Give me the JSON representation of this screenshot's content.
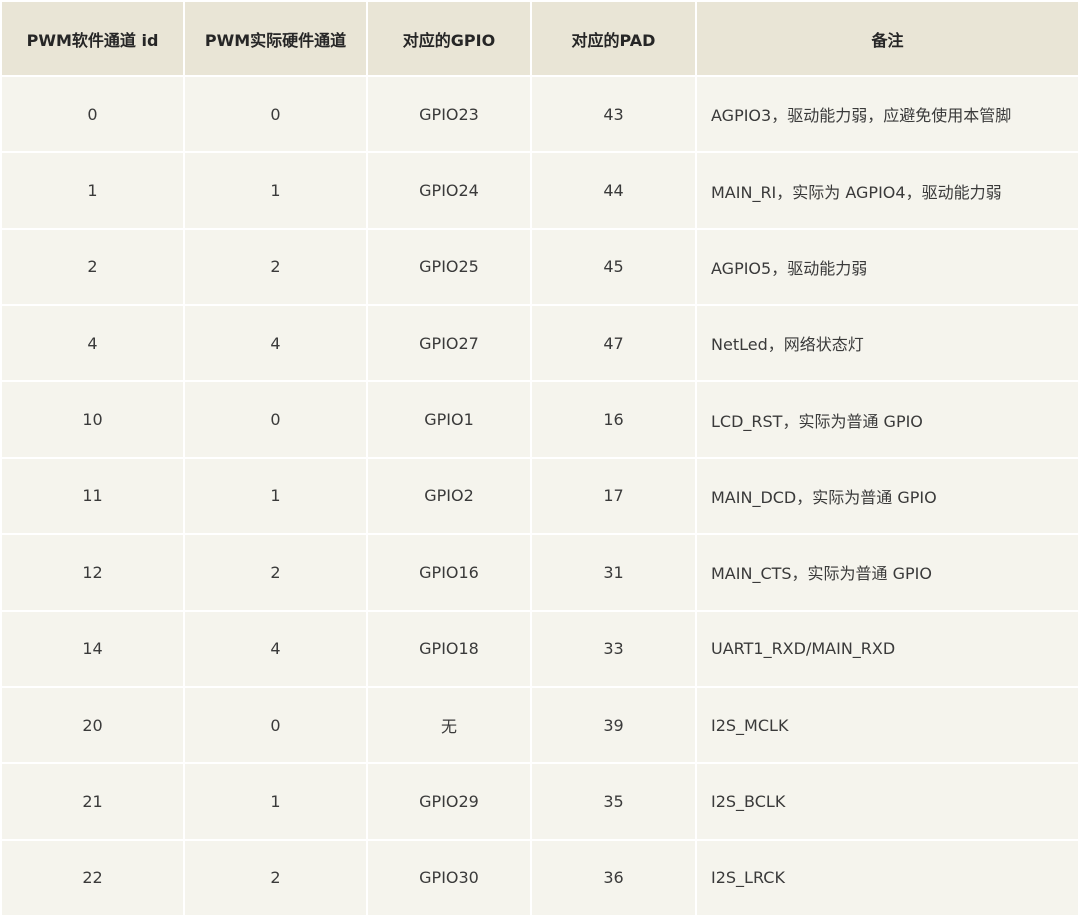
{
  "table": {
    "headers": [
      "PWM软件通道 id",
      "PWM实际硬件通道",
      "对应的GPIO",
      "对应的PAD",
      "备注"
    ],
    "rows": [
      [
        "0",
        "0",
        "GPIO23",
        "43",
        "AGPIO3，驱动能力弱，应避免使用本管脚"
      ],
      [
        "1",
        "1",
        "GPIO24",
        "44",
        "MAIN_RI，实际为 AGPIO4，驱动能力弱"
      ],
      [
        "2",
        "2",
        "GPIO25",
        "45",
        "AGPIO5，驱动能力弱"
      ],
      [
        "4",
        "4",
        "GPIO27",
        "47",
        "NetLed，网络状态灯"
      ],
      [
        "10",
        "0",
        "GPIO1",
        "16",
        "LCD_RST，实际为普通 GPIO"
      ],
      [
        "11",
        "1",
        "GPIO2",
        "17",
        "MAIN_DCD，实际为普通 GPIO"
      ],
      [
        "12",
        "2",
        "GPIO16",
        "31",
        "MAIN_CTS，实际为普通 GPIO"
      ],
      [
        "14",
        "4",
        "GPIO18",
        "33",
        "UART1_RXD/MAIN_RXD"
      ],
      [
        "20",
        "0",
        "无",
        "39",
        "I2S_MCLK"
      ],
      [
        "21",
        "1",
        "GPIO29",
        "35",
        "I2S_BCLK"
      ],
      [
        "22",
        "2",
        "GPIO30",
        "36",
        "I2S_LRCK"
      ]
    ]
  },
  "colors": {
    "header_bg": "#e9e5d6",
    "cell_bg": "#f5f4ed",
    "border": "#ffffff"
  }
}
